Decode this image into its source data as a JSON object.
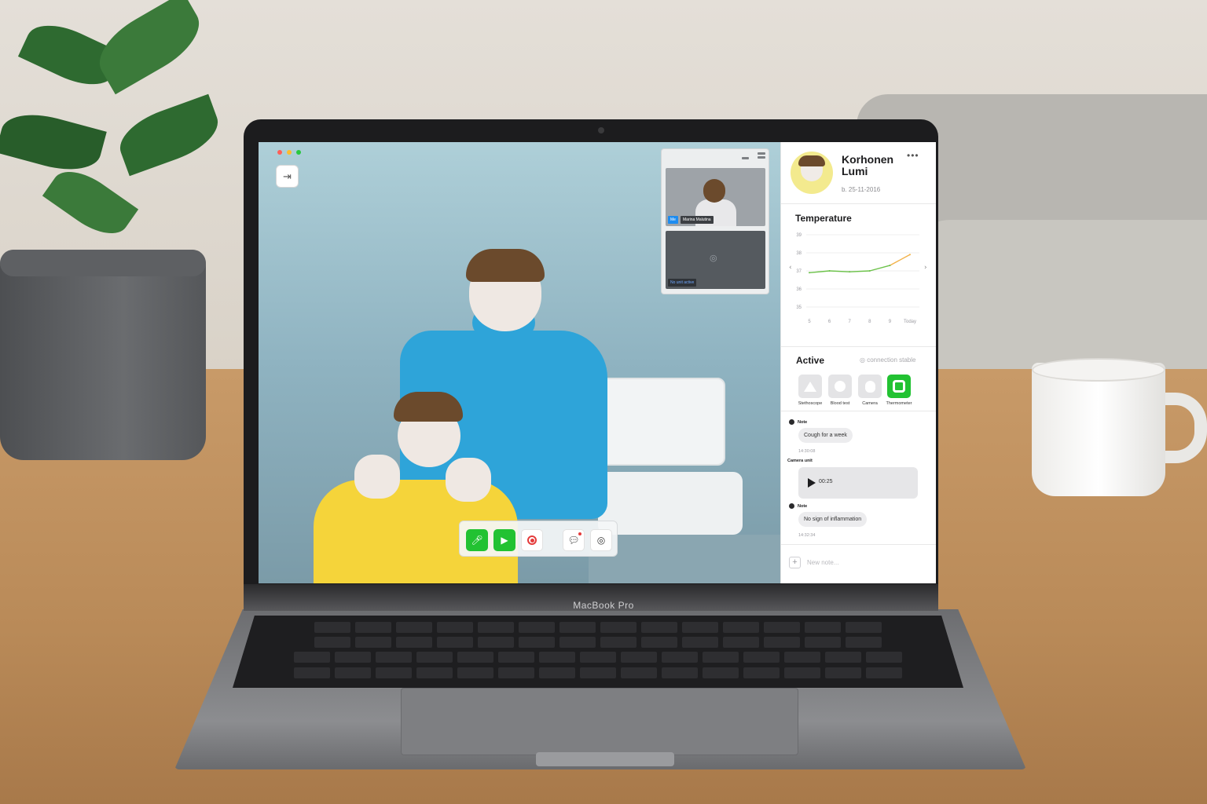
{
  "device": {
    "brand_label": "MacBook Pro"
  },
  "window": {
    "traffic_lights": [
      "#ff5f57",
      "#febc2e",
      "#28c840"
    ]
  },
  "toolbar": {
    "exit_icon": "exit-icon"
  },
  "pip": {
    "self_tag": "Me",
    "self_name": "Marina Malutina",
    "unit_status": "No unit active"
  },
  "call_controls": {
    "buttons": [
      {
        "name": "microphone",
        "icon": "microphone-icon",
        "state": "on",
        "color": "#22c232"
      },
      {
        "name": "camera",
        "icon": "video-camera-icon",
        "state": "on",
        "color": "#22c232"
      },
      {
        "name": "record",
        "icon": "record-icon",
        "color": "#e43b3b"
      },
      {
        "name": "chat",
        "icon": "chat-bubble-icon",
        "has_notification": true
      },
      {
        "name": "connection",
        "icon": "signal-icon"
      }
    ]
  },
  "patient": {
    "name_line1": "Korhonen",
    "name_line2": "Lumi",
    "dob": "b. 25-11-2016",
    "menu_icon": "more-icon"
  },
  "temperature": {
    "title": "Temperature"
  },
  "chart_data": {
    "type": "line",
    "title": "Temperature",
    "x": [
      "5",
      "6",
      "7",
      "8",
      "9",
      "Today"
    ],
    "yticks": [
      39,
      38,
      37,
      36,
      35
    ],
    "ylim": [
      35,
      39
    ],
    "series": [
      {
        "values": [
          36.9,
          37.0,
          36.95,
          37.0,
          37.3,
          37.9
        ]
      }
    ],
    "grid": true,
    "line_colors": {
      "normal": "#6cc24a",
      "elevated": "#f2b24a"
    }
  },
  "active": {
    "title": "Active",
    "connection": "connection stable",
    "devices": [
      {
        "label": "Stethoscope",
        "icon": "stethoscope-icon",
        "active": false
      },
      {
        "label": "Blood test",
        "icon": "blood-test-icon",
        "active": false
      },
      {
        "label": "Camera",
        "icon": "camera-unit-icon",
        "active": false
      },
      {
        "label": "Thermometer",
        "icon": "thermometer-icon",
        "active": true
      }
    ]
  },
  "feed": {
    "note1_label": "Note",
    "note1_text": "Cough for a week",
    "note1_time": "14:30:08",
    "camera_label": "Camera unit",
    "camera_duration": "00:25",
    "note2_label": "Note",
    "note2_text": "No sign of inflammation",
    "note2_time": "14:32:34"
  },
  "new_note": {
    "placeholder": "New note..."
  },
  "colors": {
    "accent": "#22c232",
    "record": "#e43b3b",
    "video_bg": "#9fc3cf"
  }
}
